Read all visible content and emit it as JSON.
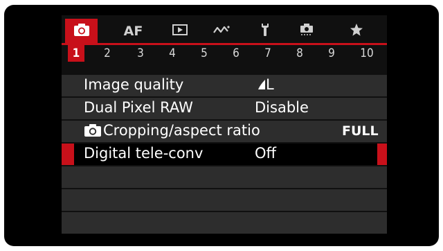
{
  "tabs": [
    {
      "icon": "camera-icon",
      "active": true
    },
    {
      "label": "AF",
      "active": false
    },
    {
      "icon": "playback-icon",
      "active": false
    },
    {
      "icon": "wireless-icon",
      "active": false
    },
    {
      "icon": "wrench-icon",
      "active": false
    },
    {
      "icon": "custom-function-icon",
      "active": false
    },
    {
      "icon": "star-icon",
      "active": false
    }
  ],
  "pages": [
    "1",
    "2",
    "3",
    "4",
    "5",
    "6",
    "7",
    "8",
    "9",
    "10"
  ],
  "active_page": "1",
  "menu": {
    "items": [
      {
        "label": "Image quality",
        "value": "L",
        "value_icon": "quality-triangle-icon"
      },
      {
        "label": "Dual Pixel RAW",
        "value": "Disable"
      },
      {
        "label": "Cropping/aspect ratio",
        "label_icon": "camera-icon",
        "value": "FULL"
      },
      {
        "label": "Digital tele-conv",
        "value": "Off",
        "selected": true
      }
    ],
    "empty_rows": 3
  },
  "colors": {
    "accent": "#c8101a",
    "row_bg": "#2d2d2d",
    "panel_bg": "#101010",
    "text": "#ffffff"
  }
}
